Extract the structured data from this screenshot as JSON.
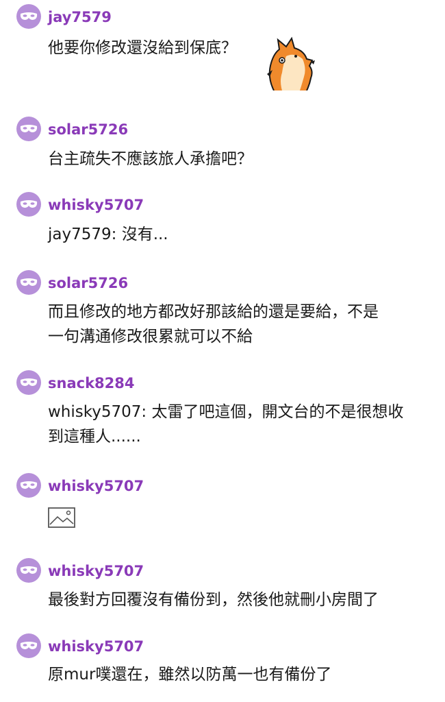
{
  "comments": [
    {
      "username": "jay7579",
      "text": "他要你修改還沒給到保底？"
    },
    {
      "username": "solar5726",
      "text": "台主疏失不應該旅人承擔吧？"
    },
    {
      "username": "whisky5707",
      "text": "jay7579: 沒有..."
    },
    {
      "username": "solar5726",
      "text": "而且修改的地方都改好那該給的還是要給，不是\n一句溝通修改很累就可以不給"
    },
    {
      "username": "snack8284",
      "text": "whisky5707: 太雷了吧這個，開文台的不是很想收\n到這種人......"
    },
    {
      "username": "whisky5707",
      "text": ""
    },
    {
      "username": "whisky5707",
      "text": "最後對方回覆沒有備份到，然後他就刪小房間了"
    },
    {
      "username": "whisky5707",
      "text": "原mur噗還在，雖然以防萬一也有備份了"
    }
  ],
  "icons": {
    "avatar": "masquerade-mask-icon",
    "sticker": "fox-sticker-image",
    "attachment": "broken-image-icon"
  },
  "colors": {
    "username": "#8a3ab8",
    "avatar_bg": "#b690d9",
    "text": "#1a1a1a",
    "background": "#ffffff"
  }
}
